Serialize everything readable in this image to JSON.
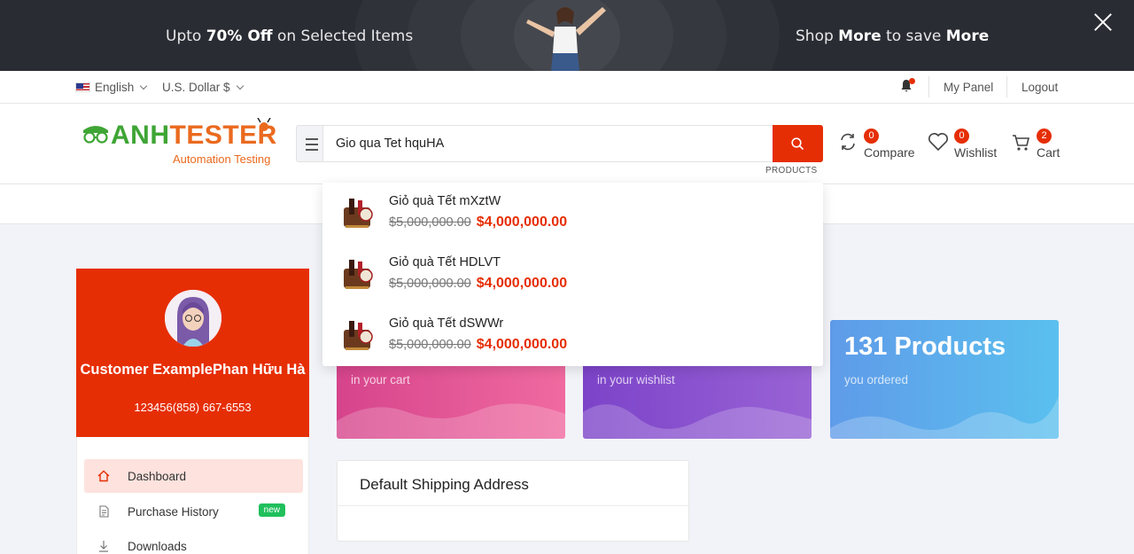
{
  "promo": {
    "left_pre": "Upto ",
    "left_bold": "70% Off",
    "left_post": " on Selected Items",
    "right_pre": "Shop ",
    "right_bold1": "More",
    "right_mid": " to save ",
    "right_bold2": "More"
  },
  "topbar": {
    "language": "English",
    "currency": "U.S. Dollar $",
    "my_panel": "My Panel",
    "logout": "Logout"
  },
  "header": {
    "logo_anh": "ANH",
    "logo_tester": "TESTER",
    "logo_sub": "Automation Testing",
    "search_value": "Gio qua Tet hquHA",
    "compare_label": "Compare",
    "compare_count": "0",
    "wishlist_label": "Wishlist",
    "wishlist_count": "0",
    "cart_label": "Cart",
    "cart_count": "2"
  },
  "search_results": {
    "section_label": "PRODUCTS",
    "items": [
      {
        "name": "Giỏ quà Tết mXztW",
        "old_price": "$5,000,000.00",
        "price": "$4,000,000.00"
      },
      {
        "name": "Giỏ quà Tết HDLVT",
        "old_price": "$5,000,000.00",
        "price": "$4,000,000.00"
      },
      {
        "name": "Giỏ quà Tết dSWWr",
        "old_price": "$5,000,000.00",
        "price": "$4,000,000.00"
      }
    ]
  },
  "profile": {
    "name": "Customer ExamplePhan Hữu Hà",
    "phone": "123456(858) 667-6553"
  },
  "sidebar": {
    "items": [
      {
        "label": "Dashboard"
      },
      {
        "label": "Purchase History",
        "badge": "new"
      },
      {
        "label": "Downloads"
      }
    ]
  },
  "cards": [
    {
      "big": "",
      "small": "in your cart"
    },
    {
      "big": "",
      "small": "in your wishlist"
    },
    {
      "big": "131 Products",
      "small": "you ordered"
    }
  ],
  "shipping": {
    "title": "Default Shipping Address"
  },
  "colors": {
    "accent": "#e62e04",
    "badge_new": "#20c05c"
  }
}
